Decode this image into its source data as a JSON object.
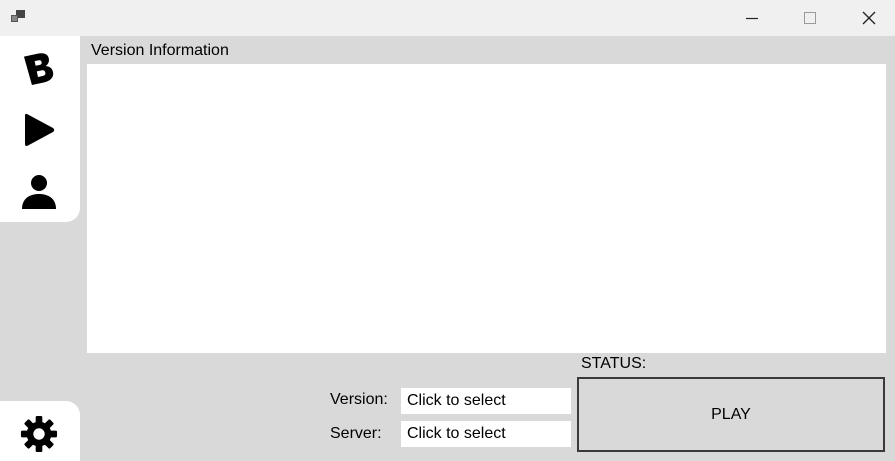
{
  "titlebar": {
    "app_icon": "app-windows-icon",
    "minimize_icon": "minimize-icon",
    "maximize_icon": "maximize-icon",
    "close_icon": "close-icon"
  },
  "sidebar": {
    "items": [
      {
        "icon": "b-logo-icon"
      },
      {
        "icon": "play-icon"
      },
      {
        "icon": "user-icon"
      }
    ],
    "bottom_icon": "gear-icon"
  },
  "main": {
    "version_info_label": "Version Information",
    "status_label": "STATUS:",
    "version_label": "Version:",
    "version_value": "Click to select",
    "server_label": "Server:",
    "server_value": "Click to select",
    "play_label": "PLAY"
  },
  "colors": {
    "background": "#d9d9d9",
    "panel": "#ffffff",
    "titlebar": "#f0f0f0"
  }
}
